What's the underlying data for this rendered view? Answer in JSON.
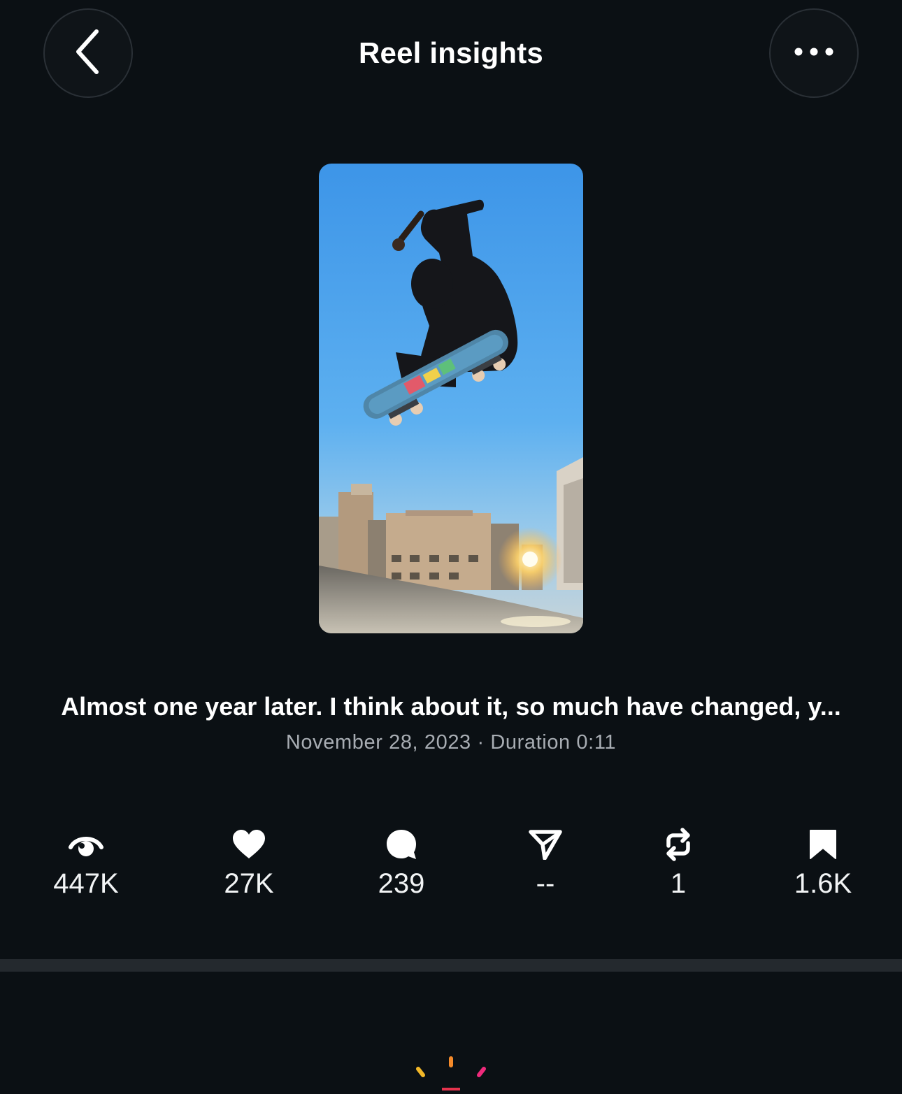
{
  "header": {
    "title": "Reel insights",
    "back_icon": "chevron-left-icon",
    "more_icon": "more-horizontal-icon"
  },
  "reel": {
    "thumbnail": "skateboarder-kickflip-thumbnail",
    "caption": "Almost one year later. I think about it, so much have changed, y...",
    "meta": "November 28, 2023 · Duration 0:11"
  },
  "stats": [
    {
      "icon": "eye-icon",
      "value": "447K"
    },
    {
      "icon": "heart-icon",
      "value": "27K"
    },
    {
      "icon": "comment-icon",
      "value": "239"
    },
    {
      "icon": "send-icon",
      "value": "--"
    },
    {
      "icon": "repost-icon",
      "value": "1"
    },
    {
      "icon": "bookmark-icon",
      "value": "1.6K"
    }
  ],
  "colors": {
    "background": "#0b1014",
    "divider": "#24292e",
    "meta_text": "#a8adb3"
  }
}
